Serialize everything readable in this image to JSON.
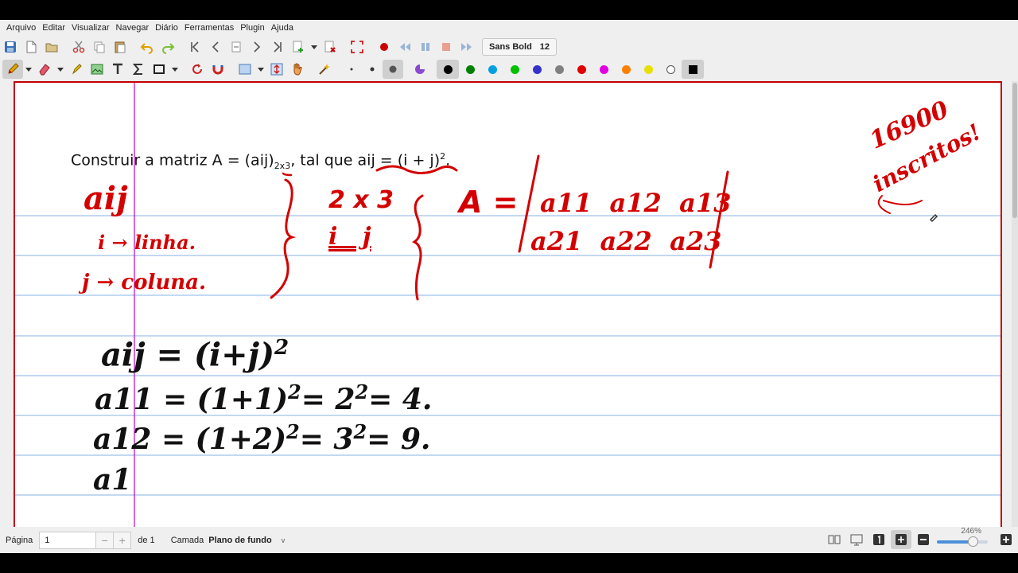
{
  "menu": [
    "Arquivo",
    "Editar",
    "Visualizar",
    "Navegar",
    "Diário",
    "Ferramentas",
    "Plugin",
    "Ajuda"
  ],
  "toolbar": {
    "font_name": "Sans Bold",
    "font_size": "12"
  },
  "colors": {
    "palette": [
      "#000000",
      "#008000",
      "#00a0e0",
      "#00c000",
      "#3333cc",
      "#808080",
      "#e00000",
      "#e000e0",
      "#ff8000",
      "#e8e000",
      "#ffffff",
      "#000000"
    ],
    "ink": "#d40000",
    "rule_line": "#86b3e6",
    "margin_line": "#c000c0"
  },
  "note": {
    "problem_text_a": "Construir a matriz A = (aij)",
    "problem_sub": "2x3",
    "problem_text_b": ", tal que aij = (i + j)",
    "problem_sup": "2",
    "problem_end": ".",
    "red_notes": {
      "aij": "aij",
      "linha": "i → linha.",
      "coluna": "j → coluna.",
      "dims": "2 x 3",
      "ij": "i   j",
      "A_eq": "A =",
      "row1": "a11  a12  a13",
      "row2": "a21  a22  a23",
      "corner1": "16900",
      "corner2": "inscritos!"
    },
    "black_notes": {
      "line1": "aij = (i+j)",
      "line1_exp": "2",
      "line2": "a11 = (1+1)",
      "line2_rest": "= 2",
      "line2_end": "= 4.",
      "line3": "a12 = (1+2)",
      "line3_rest": "= 3",
      "line3_end": "= 9.",
      "line4": "a1"
    }
  },
  "status": {
    "page_label": "Página",
    "page_value": "1",
    "of_label": "de 1",
    "layer_label": "Camada",
    "layer_value": "Plano de fundo",
    "zoom": "246%",
    "zoom_fraction": 0.7
  }
}
